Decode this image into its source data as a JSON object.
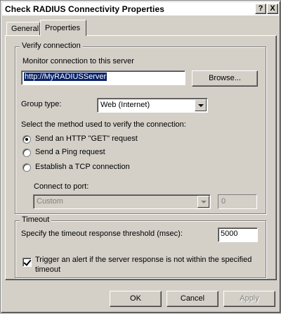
{
  "window": {
    "title": "Check RADIUS Connectivity Properties",
    "help_glyph": "?",
    "close_glyph": "X"
  },
  "tabs": [
    {
      "label": "General",
      "selected": false
    },
    {
      "label": "Properties",
      "selected": true
    }
  ],
  "verify": {
    "legend": "Verify connection",
    "monitor_label": "Monitor connection to this server",
    "server_value": "http://MyRADIUSServer",
    "browse_label": "Browse...",
    "group_type_label": "Group type:",
    "group_type_value": "Web (Internet)",
    "method_label": "Select the method used to verify the connection:",
    "methods": [
      {
        "label": "Send an HTTP \"GET\" request",
        "checked": true
      },
      {
        "label": "Send a Ping request",
        "checked": false
      },
      {
        "label": "Establish a TCP connection",
        "checked": false
      }
    ],
    "port_label": "Connect to port:",
    "port_type_value": "Custom",
    "port_number_value": "0"
  },
  "timeout": {
    "legend": "Timeout",
    "threshold_label": "Specify the timeout response threshold (msec):",
    "threshold_value": "5000",
    "alert_label_line1": "Trigger an alert if the server response is not within the specified",
    "alert_label_line2": "timeout",
    "alert_checked": true
  },
  "buttons": {
    "ok": "OK",
    "cancel": "Cancel",
    "apply": "Apply"
  },
  "colors": {
    "face": "#d4d0c8",
    "selection": "#0a246a",
    "disabled_text": "#808080"
  }
}
